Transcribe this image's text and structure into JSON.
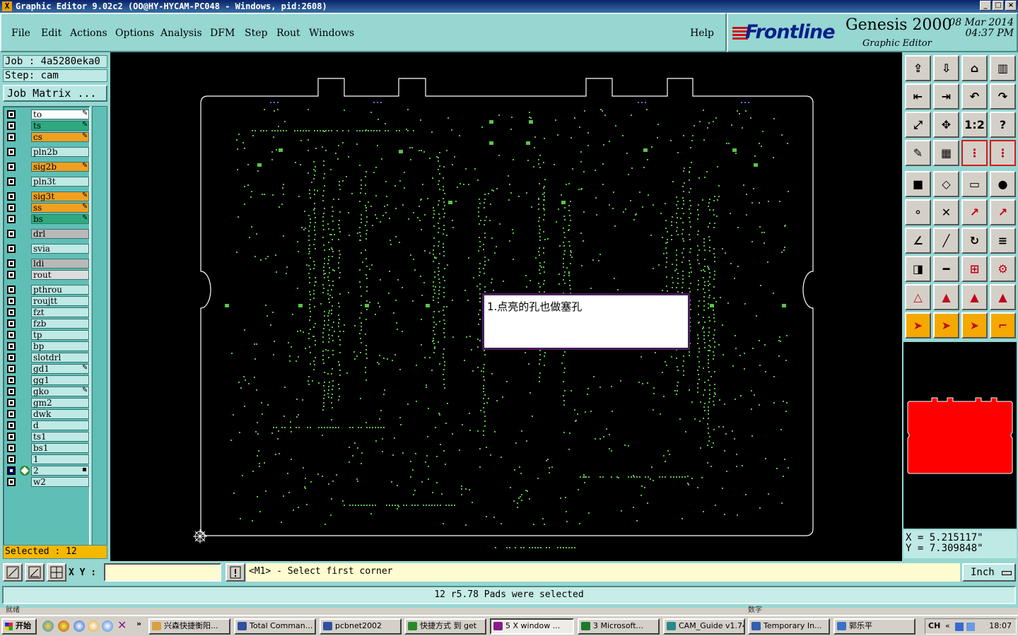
{
  "window": {
    "title": "Graphic Editor 9.02c2 (OO@HY-HYCAM-PC048 - Windows, pid:2608)",
    "controls": [
      "_",
      "□",
      "×"
    ]
  },
  "menu": {
    "items": [
      "File",
      "Edit",
      "Actions",
      "Options",
      "Analysis",
      "DFM",
      "Step",
      "Rout",
      "Windows"
    ],
    "help": "Help"
  },
  "brand": {
    "logo": "Frontline",
    "product": "Genesis 2000",
    "subtitle": "Graphic Editor",
    "date": "08 Mar 2014",
    "time": "04:37 PM"
  },
  "job": {
    "job_label": "Job : 4a5280eka0",
    "step_label": "Step: cam",
    "matrix_button": "Job Matrix ..."
  },
  "layers": [
    {
      "name": "to",
      "color": "white",
      "mark": "✎"
    },
    {
      "name": "ts",
      "color": "green",
      "mark": "✎"
    },
    {
      "name": "cs",
      "color": "orange",
      "mark": "✎"
    },
    {
      "name": "pln2b",
      "color": "teal",
      "mark": ""
    },
    {
      "name": "sig2b",
      "color": "orange",
      "mark": "✎"
    },
    {
      "name": "pln3t",
      "color": "teal",
      "mark": ""
    },
    {
      "name": "sig3t",
      "color": "orange",
      "mark": "✎"
    },
    {
      "name": "ss",
      "color": "orange",
      "mark": "✎"
    },
    {
      "name": "bs",
      "color": "green",
      "mark": "✎"
    },
    {
      "name": "drl",
      "color": "gray",
      "mark": ""
    },
    {
      "name": "svia",
      "color": "teal",
      "mark": ""
    },
    {
      "name": "ldi",
      "color": "gray",
      "mark": ""
    },
    {
      "name": "rout",
      "color": "ltgray",
      "mark": ""
    },
    {
      "name": "pthrou",
      "color": "teal",
      "mark": ""
    },
    {
      "name": "roujtt",
      "color": "teal",
      "mark": ""
    },
    {
      "name": "fzt",
      "color": "teal",
      "mark": ""
    },
    {
      "name": "fzb",
      "color": "teal",
      "mark": ""
    },
    {
      "name": "tp",
      "color": "teal",
      "mark": ""
    },
    {
      "name": "bp",
      "color": "teal",
      "mark": ""
    },
    {
      "name": "slotdrl",
      "color": "teal",
      "mark": ""
    },
    {
      "name": "gd1",
      "color": "teal",
      "mark": "✎"
    },
    {
      "name": "gg1",
      "color": "teal",
      "mark": ""
    },
    {
      "name": "gko",
      "color": "teal",
      "mark": "✎"
    },
    {
      "name": "gm2",
      "color": "teal",
      "mark": ""
    },
    {
      "name": "dwk",
      "color": "teal",
      "mark": ""
    },
    {
      "name": "d",
      "color": "teal",
      "mark": ""
    },
    {
      "name": "ts1",
      "color": "teal",
      "mark": ""
    },
    {
      "name": "bs1",
      "color": "teal",
      "mark": ""
    },
    {
      "name": "1",
      "color": "teal",
      "mark": ""
    },
    {
      "name": "2",
      "color": "teal",
      "mark": "▪",
      "work": true
    },
    {
      "name": "w2",
      "color": "teal",
      "mark": ""
    }
  ],
  "selected_count": "Selected : 12",
  "note_text": "1.点亮的孔也做塞孔",
  "coords": {
    "x": "X  =  5.215117\"",
    "y": "Y  =  7.309848\""
  },
  "command": {
    "xy_label": "X Y :",
    "xy_value": "",
    "prompt": "<M1> - Select first corner",
    "unit": "Inch"
  },
  "status": "12 r5.78 Pads were selected",
  "status_left": "就绪",
  "status_right": "数字",
  "colors": {
    "panel": "#96d7d2",
    "board_outline": "#ffffff",
    "pads": "#5cc24a",
    "overview_fill": "#ff0000",
    "selected_bg": "#f5b800"
  },
  "taskbar": {
    "start": "开始",
    "tasks": [
      "兴森快捷衡阳...",
      "Total Comman...",
      "pcbnet2002",
      "快捷方式 到 get",
      "5 X window ...",
      "3 Microsoft...",
      "CAM_Guide v1.74",
      "Temporary In...",
      "郭乐平"
    ],
    "ime": "CH",
    "clock": "18:07"
  }
}
